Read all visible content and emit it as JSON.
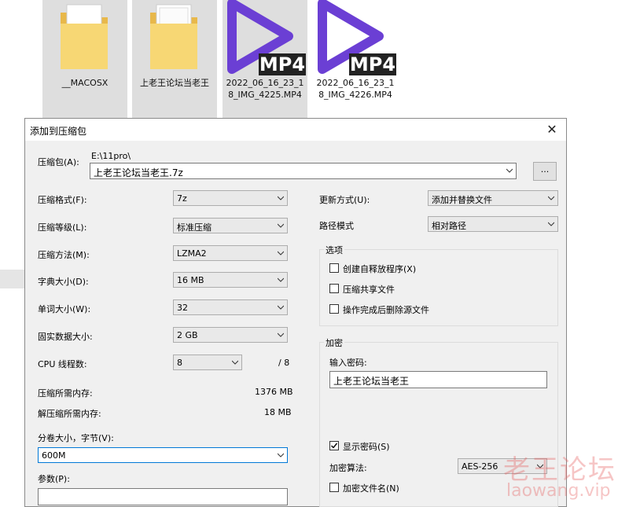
{
  "explorer": {
    "files": [
      {
        "name": "__MACOSX",
        "type": "folder",
        "selected": true
      },
      {
        "name": "上老王论坛当老王",
        "type": "folder",
        "selected": true
      },
      {
        "name": "2022_06_16_23_18_IMG_4225.MP4",
        "type": "mp4",
        "selected": true,
        "badge": "MP4"
      },
      {
        "name": "2022_06_16_23_18_IMG_4226.MP4",
        "type": "mp4",
        "selected": false,
        "badge": "MP4"
      }
    ]
  },
  "dialog": {
    "title": "添加到压缩包",
    "archive_label": "压缩包(A):",
    "archive_path": "E:\\11pro\\",
    "archive_name": "上老王论坛当老王.7z",
    "browse_label": "...",
    "format_label": "压缩格式(F):",
    "format_value": "7z",
    "level_label": "压缩等级(L):",
    "level_value": "标准压缩",
    "method_label": "压缩方法(M):",
    "method_value": "LZMA2",
    "dict_label": "字典大小(D):",
    "dict_value": "16 MB",
    "word_label": "单词大小(W):",
    "word_value": "32",
    "solid_label": "固实数据大小:",
    "solid_value": "2 GB",
    "threads_label": "CPU 线程数:",
    "threads_value": "8",
    "threads_total": "/ 8",
    "mem_compress_label": "压缩所需内存:",
    "mem_compress_value": "1376 MB",
    "mem_decompress_label": "解压缩所需内存:",
    "mem_decompress_value": "18 MB",
    "split_label": "分卷大小，字节(V):",
    "split_value": "600M",
    "params_label": "参数(P):",
    "params_value": "",
    "update_label": "更新方式(U):",
    "update_value": "添加并替换文件",
    "path_label": "路径模式",
    "path_value": "相对路径",
    "options_group": "选项",
    "opt_sfx": "创建自释放程序(X)",
    "opt_shared": "压缩共享文件",
    "opt_delete": "操作完成后删除源文件",
    "enc_group": "加密",
    "enc_pwd_label": "输入密码:",
    "enc_pwd_value": "上老王论坛当老王",
    "show_pwd": "显示密码(S)",
    "show_pwd_checked": true,
    "enc_method_label": "加密算法:",
    "enc_method_value": "AES-256",
    "enc_names": "加密文件名(N)",
    "enc_names_checked": false
  },
  "watermark": {
    "line1": "老王论坛",
    "line2": "laowang.vip"
  },
  "colors": {
    "mp4_purple": "#6b3fd4",
    "folder_yellow": "#f7d774",
    "dialog_bg": "#f0f0f0"
  }
}
